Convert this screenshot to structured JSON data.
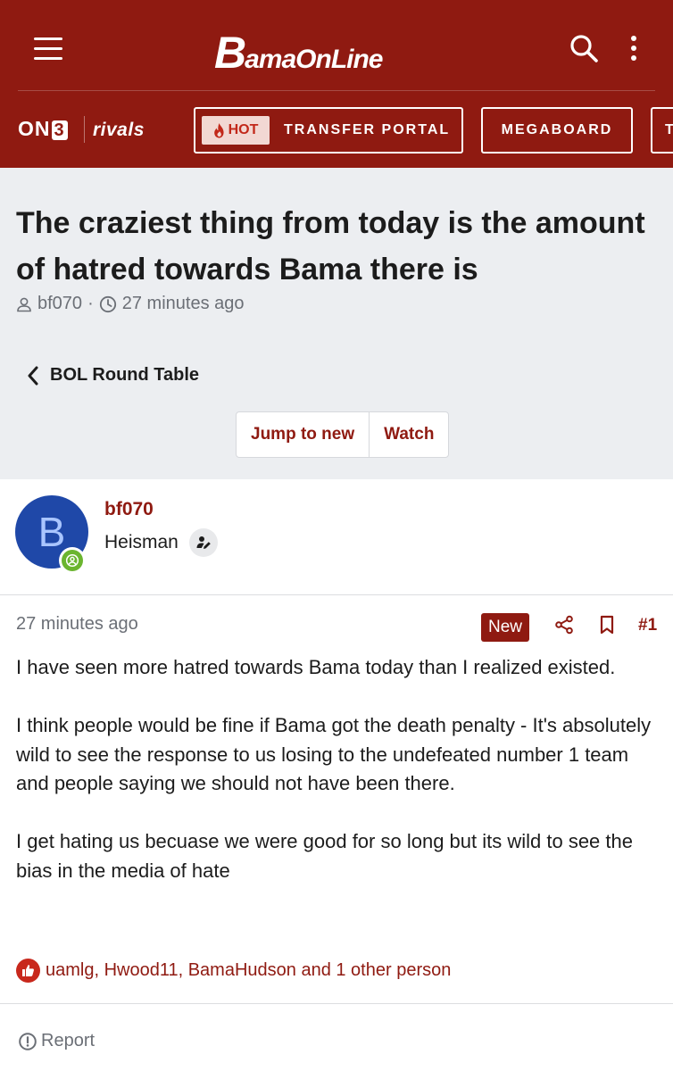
{
  "header": {
    "logo_b": "B",
    "logo_rest": "amaOnLine",
    "on3_text": "ON",
    "on3_digit": "3",
    "rivals_text": "rivals",
    "nav": {
      "hot_label": "HOT",
      "transfer_label": "TRANSFER PORTAL",
      "megaboard_label": "MEGABOARD",
      "next_label": "T"
    },
    "brand_color": "#8f1a11"
  },
  "thread": {
    "title": "The craziest thing from today is the amount of hatred towards Bama there is",
    "author": "bf070",
    "separator": "·",
    "time": "27 minutes ago",
    "forum": "BOL Round Table",
    "jump_label": "Jump to new",
    "watch_label": "Watch"
  },
  "post": {
    "avatar_letter": "B",
    "username": "bf070",
    "user_title": "Heisman",
    "time": "27 minutes ago",
    "new_label": "New",
    "number": "#1",
    "paragraphs": [
      "I have seen more hatred towards Bama today than I realized existed.",
      "I think people would be fine if Bama got the death penalty - It's absolutely wild to see the response to us losing to the undefeated number 1 team and people saying we should not have been there.",
      "I get hating us becuase we were good for so long but its wild to see the bias in the media of hate"
    ],
    "reactions_text": "uamlg, Hwood11, BamaHudson and 1 other person",
    "report_label": "Report"
  },
  "icons": {
    "menu": "hamburger-icon",
    "search": "search-icon",
    "more": "kebab-icon",
    "user": "user-icon",
    "clock": "clock-icon",
    "back": "chevron-left-icon",
    "share": "share-icon",
    "bookmark": "bookmark-icon",
    "like": "thumbs-up-icon",
    "report": "alert-circle-icon"
  }
}
